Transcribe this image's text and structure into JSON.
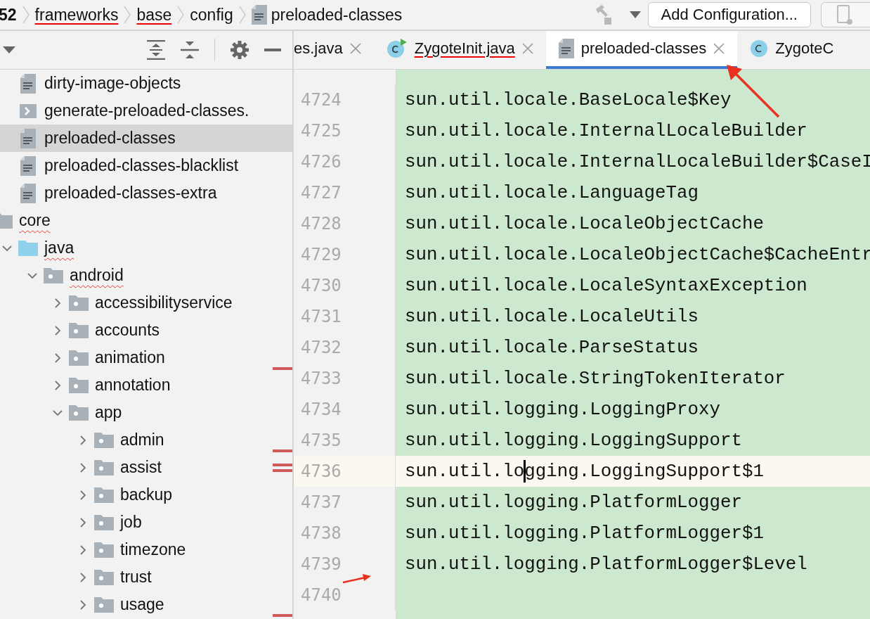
{
  "breadcrumb": [
    {
      "label": "52",
      "underlined": false,
      "kind": "folder"
    },
    {
      "label": "frameworks",
      "underlined": true,
      "kind": "folder"
    },
    {
      "label": "base",
      "underlined": true,
      "kind": "folder"
    },
    {
      "label": "config",
      "underlined": false,
      "kind": "folder"
    },
    {
      "label": "preloaded-classes",
      "underlined": false,
      "kind": "file"
    }
  ],
  "run_toolbar": {
    "button": "Add Configuration..."
  },
  "tabs": [
    {
      "label": "es.java",
      "kind": "plain",
      "underlined": false,
      "selected": false,
      "closable": true
    },
    {
      "label": "ZygoteInit.java",
      "kind": "class_run",
      "underlined": true,
      "selected": false,
      "closable": true
    },
    {
      "label": "preloaded-classes",
      "kind": "file",
      "underlined": false,
      "selected": true,
      "closable": true
    },
    {
      "label": "ZygoteC",
      "kind": "class",
      "underlined": false,
      "selected": false,
      "closable": false
    }
  ],
  "config_files": [
    {
      "label": "dirty-image-objects",
      "kind": "file",
      "selected": false
    },
    {
      "label": "generate-preloaded-classes.",
      "kind": "script",
      "selected": false
    },
    {
      "label": "preloaded-classes",
      "kind": "file",
      "selected": true
    },
    {
      "label": "preloaded-classes-blacklist",
      "kind": "file",
      "selected": false
    },
    {
      "label": "preloaded-classes-extra",
      "kind": "file",
      "selected": false
    }
  ],
  "tree": [
    {
      "label": "core",
      "kind": "folder",
      "misspelled": true,
      "children": [
        {
          "label": "java",
          "kind": "source_folder",
          "misspelled": true,
          "expanded": true,
          "children": [
            {
              "label": "android",
              "kind": "package",
              "misspelled": true,
              "expanded": true,
              "children": [
                {
                  "label": "accessibilityservice",
                  "kind": "package",
                  "expanded": false,
                  "error_stripe": false
                },
                {
                  "label": "accounts",
                  "kind": "package",
                  "expanded": false,
                  "error_stripe": false
                },
                {
                  "label": "animation",
                  "kind": "package",
                  "expanded": false,
                  "error_stripe": true,
                  "stripe_doubled": false
                },
                {
                  "label": "annotation",
                  "kind": "package",
                  "expanded": false,
                  "error_stripe": false
                },
                {
                  "label": "app",
                  "kind": "package",
                  "expanded": true,
                  "error_stripe": false,
                  "children": [
                    {
                      "label": "admin",
                      "kind": "package",
                      "expanded": false,
                      "error_stripe": true,
                      "stripe_doubled": false
                    },
                    {
                      "label": "assist",
                      "kind": "package",
                      "expanded": false,
                      "error_stripe": true,
                      "stripe_doubled": true
                    },
                    {
                      "label": "backup",
                      "kind": "package",
                      "expanded": false,
                      "error_stripe": false
                    },
                    {
                      "label": "job",
                      "kind": "package",
                      "expanded": false,
                      "error_stripe": false
                    },
                    {
                      "label": "timezone",
                      "kind": "package",
                      "expanded": false,
                      "error_stripe": false
                    },
                    {
                      "label": "trust",
                      "kind": "package",
                      "expanded": false,
                      "error_stripe": false
                    },
                    {
                      "label": "usage",
                      "kind": "package",
                      "expanded": false,
                      "error_stripe": true,
                      "stripe_doubled": false
                    }
                  ]
                }
              ]
            }
          ]
        }
      ]
    }
  ],
  "editor": {
    "lines": [
      {
        "number": "4724",
        "text": "sun.util.locale.BaseLocale$Key",
        "current": false
      },
      {
        "number": "4725",
        "text": "sun.util.locale.InternalLocaleBuilder",
        "current": false
      },
      {
        "number": "4726",
        "text": "sun.util.locale.InternalLocaleBuilder$CaseI",
        "current": false
      },
      {
        "number": "4727",
        "text": "sun.util.locale.LanguageTag",
        "current": false
      },
      {
        "number": "4728",
        "text": "sun.util.locale.LocaleObjectCache",
        "current": false
      },
      {
        "number": "4729",
        "text": "sun.util.locale.LocaleObjectCache$CacheEntr",
        "current": false
      },
      {
        "number": "4730",
        "text": "sun.util.locale.LocaleSyntaxException",
        "current": false
      },
      {
        "number": "4731",
        "text": "sun.util.locale.LocaleUtils",
        "current": false
      },
      {
        "number": "4732",
        "text": "sun.util.locale.ParseStatus",
        "current": false
      },
      {
        "number": "4733",
        "text": "sun.util.locale.StringTokenIterator",
        "current": false
      },
      {
        "number": "4734",
        "text": "sun.util.logging.LoggingProxy",
        "current": false
      },
      {
        "number": "4735",
        "text": "sun.util.logging.LoggingSupport",
        "current": false
      },
      {
        "number": "4736",
        "text": "sun.util.logging.LoggingSupport$1",
        "current": true
      },
      {
        "number": "4737",
        "text": "sun.util.logging.PlatformLogger",
        "current": false
      },
      {
        "number": "4738",
        "text": "sun.util.logging.PlatformLogger$1",
        "current": false
      },
      {
        "number": "4739",
        "text": "sun.util.logging.PlatformLogger$Level",
        "current": false
      },
      {
        "number": "4740",
        "current": false
      }
    ]
  },
  "annotations": [
    {
      "kind": "arrow"
    },
    {
      "kind": "arrow"
    }
  ]
}
